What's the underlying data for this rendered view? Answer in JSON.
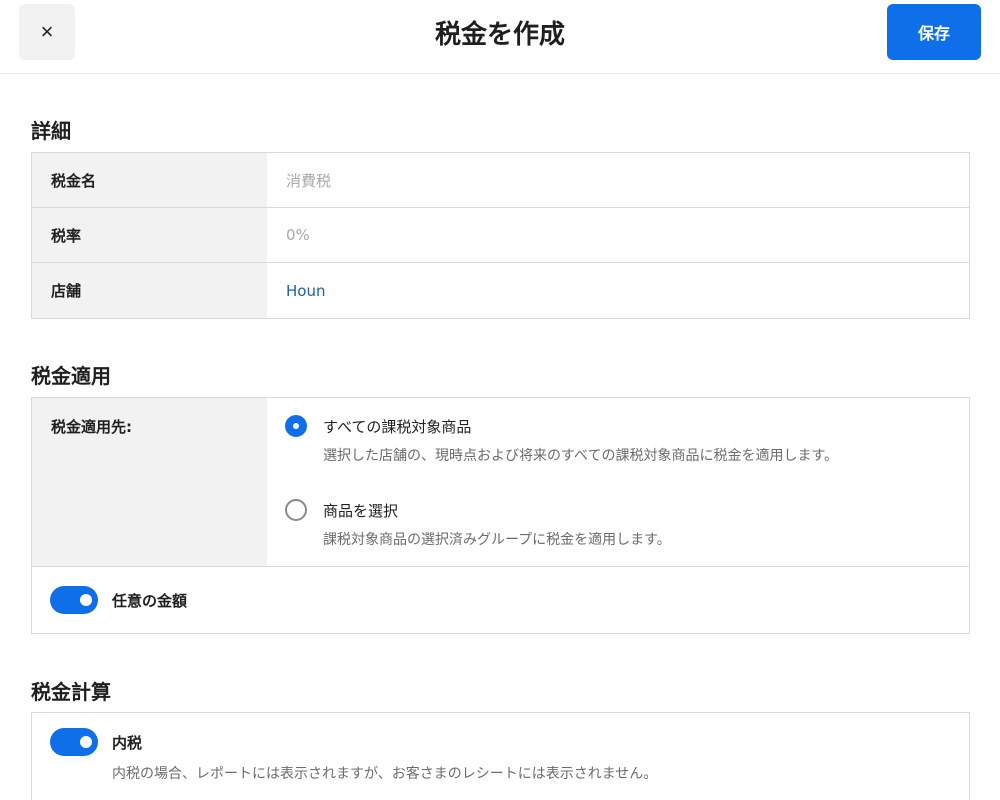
{
  "header": {
    "close_icon": "×",
    "title": "税金を作成",
    "save_label": "保存"
  },
  "details": {
    "title": "詳細",
    "rows": [
      {
        "label": "税金名",
        "value": "消費税",
        "state": "placeholder"
      },
      {
        "label": "税率",
        "value": "0%",
        "state": "placeholder"
      },
      {
        "label": "店舗",
        "value": "Houn",
        "state": "link"
      }
    ]
  },
  "application": {
    "title": "税金適用",
    "apply_label": "税金適用先:",
    "options": [
      {
        "title": "すべての課税対象商品",
        "description": "選択した店舗の、現時点および将来のすべての課税対象商品に税金を適用します。",
        "selected": true
      },
      {
        "title": "商品を選択",
        "description": "課税対象商品の選択済みグループに税金を適用します。",
        "selected": false
      }
    ],
    "toggle_label": "任意の金額",
    "toggle_on": true
  },
  "calculation": {
    "title": "税金計算",
    "toggle_label": "内税",
    "toggle_description": "内税の場合、レポートには表示されますが、お客さまのレシートには表示されません。",
    "toggle_on": true
  },
  "colors": {
    "accent": "#0f6fe8",
    "link": "#1a5fb4",
    "label_bg": "#f2f2f2"
  }
}
